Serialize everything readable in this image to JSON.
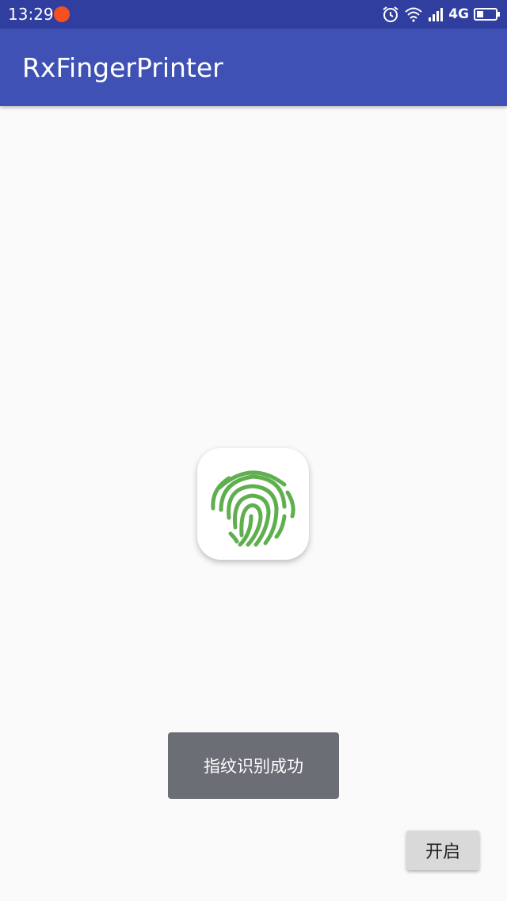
{
  "status_bar": {
    "time": "13:29",
    "network_label": "4G",
    "icons": [
      "app-notification-icon",
      "alarm-icon",
      "wifi-icon",
      "signal-icon",
      "battery-icon"
    ]
  },
  "app_bar": {
    "title": "RxFingerPrinter"
  },
  "fingerprint": {
    "icon": "fingerprint-icon",
    "color": "#5faf4f"
  },
  "toast": {
    "message": "指纹识别成功"
  },
  "start_button": {
    "label": "开启"
  },
  "colors": {
    "status_bar": "#303f9f",
    "app_bar": "#3f51b5",
    "background": "#fafafa",
    "toast": "#6b6e75",
    "button": "#d9d9d9"
  }
}
